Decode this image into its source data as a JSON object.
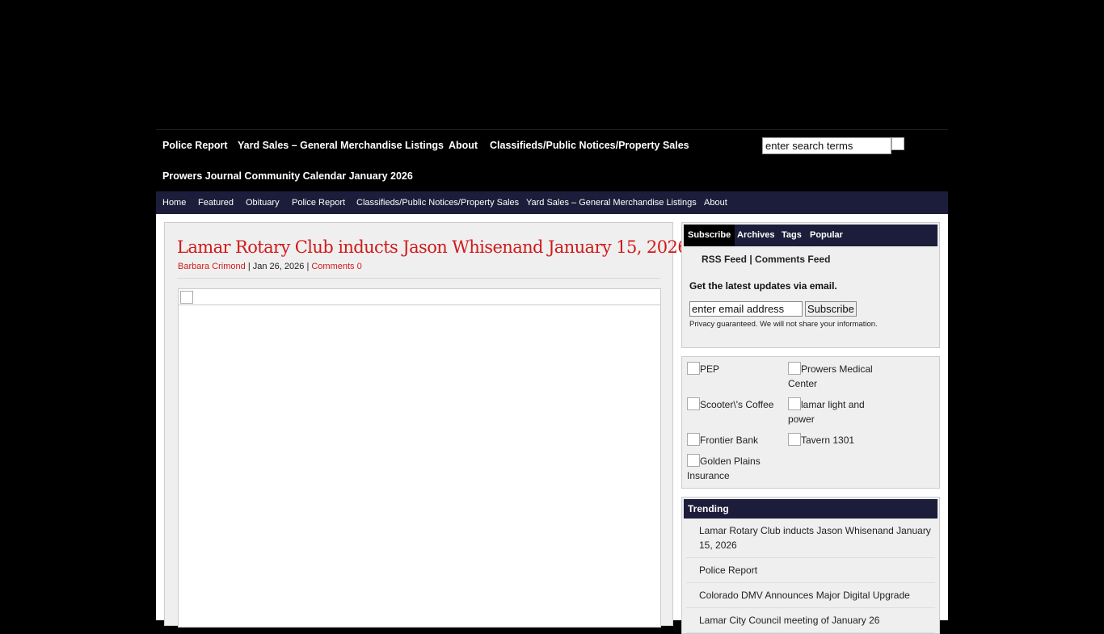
{
  "top_nav": {
    "items": [
      "Police Report",
      "Yard Sales – General Merchandise Listings",
      "About",
      "Classifieds/Public Notices/Property Sales",
      "Prowers Journal Community Calendar January 2026"
    ],
    "search_placeholder": "enter search terms"
  },
  "category_nav": {
    "items": [
      "Home",
      "Featured",
      "Obituary",
      "Police Report",
      "Classifieds/Public Notices/Property Sales",
      "Yard Sales – General Merchandise Listings",
      "About"
    ]
  },
  "post": {
    "title": "Lamar Rotary Club inducts Jason Whisenand January 15, 2026",
    "author": "Barbara Crimond",
    "date": "Jan 26, 2026",
    "comments": "Comments 0",
    "separator": "|"
  },
  "sidebar": {
    "tabs": [
      "Subscribe",
      "Archives",
      "Tags",
      "Popular"
    ],
    "feeds": "RSS Feed | Comments Feed",
    "latest_label": "Get the latest updates via email.",
    "email_placeholder": "enter email address",
    "subscribe_label": "Subscribe",
    "privacy": "Privacy guaranteed. We will not share your information.",
    "ads": [
      "PEP",
      "Prowers Medical Center",
      "Scooter\\'s Coffee",
      "lamar light and power",
      "Frontier Bank",
      "Tavern 1301",
      "Golden Plains Insurance"
    ],
    "trending_title": "Trending",
    "trending": [
      "Lamar Rotary Club inducts Jason Whisenand January 15, 2026",
      "Police Report",
      "Colorado DMV Announces Major Digital Upgrade",
      "Lamar City Council meeting of January 26"
    ]
  },
  "colors": {
    "nav_bg": "#1c1d3a",
    "title_red": "#d11a1a",
    "page_bg": "#000000"
  },
  "icons": [
    "search-button-icon",
    "broken-image-icon"
  ]
}
